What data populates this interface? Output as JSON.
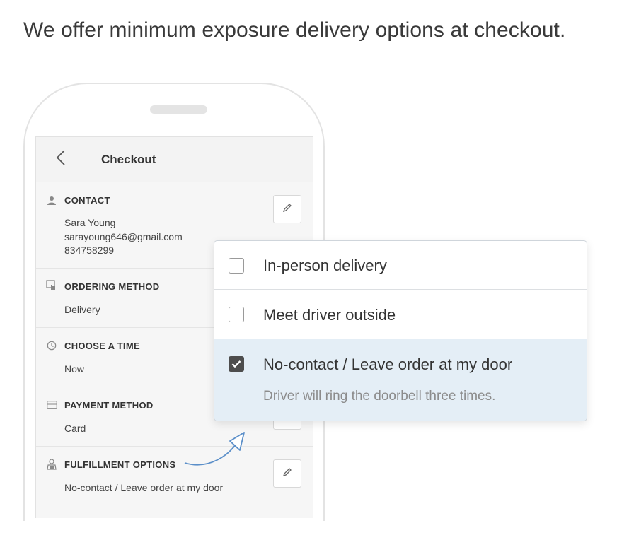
{
  "headline": "We offer minimum exposure delivery options at checkout.",
  "app": {
    "title": "Checkout",
    "back_icon": "chevron-left-icon"
  },
  "sections": {
    "contact": {
      "title": "CONTACT",
      "name": "Sara Young",
      "email": "sarayoung646@gmail.com",
      "phone": "834758299",
      "icon": "person-icon"
    },
    "ordering": {
      "title": "ORDERING METHOD",
      "value": "Delivery",
      "icon": "hand-tap-icon"
    },
    "time": {
      "title": "CHOOSE A TIME",
      "value": "Now",
      "icon": "clock-icon"
    },
    "payment": {
      "title": "PAYMENT METHOD",
      "value": "Card",
      "icon": "credit-card-icon"
    },
    "fulfillment": {
      "title": "FULFILLMENT OPTIONS",
      "value": "No-contact / Leave order at my door",
      "icon": "delivery-person-icon"
    }
  },
  "delivery_options": [
    {
      "label": "In-person delivery",
      "checked": false
    },
    {
      "label": "Meet driver outside",
      "checked": false
    },
    {
      "label": "No-contact / Leave order at my door",
      "checked": true,
      "description": "Driver will ring the doorbell three times."
    }
  ],
  "colors": {
    "selected_bg": "#e4eef6",
    "arrow": "#5b8fc9",
    "checkbox_checked": "#4d4d4d"
  }
}
